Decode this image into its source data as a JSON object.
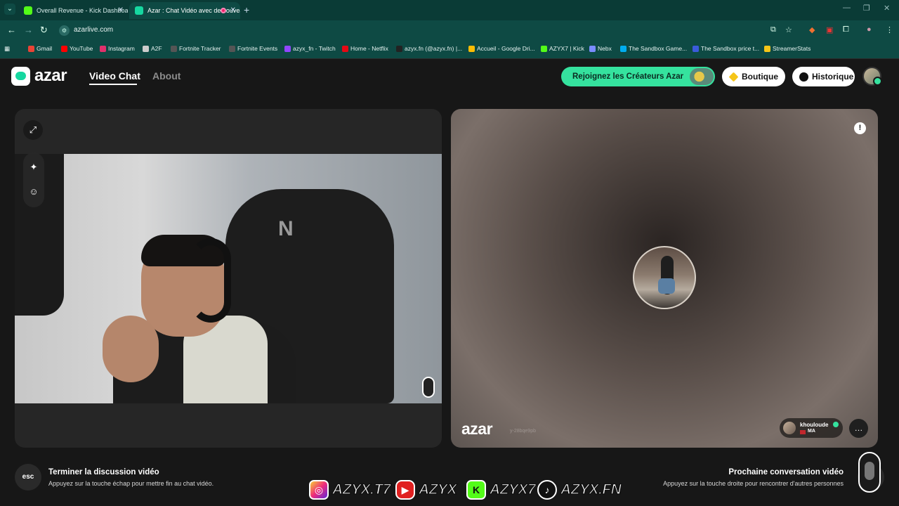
{
  "browser": {
    "tabs": [
      {
        "title": "Overall Revenue - Kick Dashboard",
        "active": false,
        "favicon_color": "#53fc18"
      },
      {
        "title": "Azar : Chat Vidéo avec de nouveaux",
        "active": true,
        "favicon_color": "#16d7a0"
      }
    ],
    "url": "azarlive.com",
    "bookmarks": [
      {
        "label": "Gmail",
        "icon_color": "#ea4335"
      },
      {
        "label": "YouTube",
        "icon_color": "#ff0000"
      },
      {
        "label": "Instagram",
        "icon_color": "#e1306c"
      },
      {
        "label": "A2F",
        "icon_color": "#cccccc"
      },
      {
        "label": "Fortnite Tracker",
        "icon_color": "#333333"
      },
      {
        "label": "Fortnite Events",
        "icon_color": "#333333"
      },
      {
        "label": "azyx_fn - Twitch",
        "icon_color": "#9146ff"
      },
      {
        "label": "Home - Netflix",
        "icon_color": "#e50914"
      },
      {
        "label": "azyx.fn (@azyx.fn) |...",
        "icon_color": "#111111"
      },
      {
        "label": "Accueil - Google Dri...",
        "icon_color": "#fbbc04"
      },
      {
        "label": "AZYX7 | Kick",
        "icon_color": "#53fc18"
      },
      {
        "label": "Nebx",
        "icon_color": "#7a8cff"
      },
      {
        "label": "The Sandbox Game...",
        "icon_color": "#00adef"
      },
      {
        "label": "The Sandbox price t...",
        "icon_color": "#3b5bdb"
      },
      {
        "label": "StreamerStats",
        "icon_color": "#f5c518"
      }
    ]
  },
  "header": {
    "logo_text": "azar",
    "nav": {
      "video_chat": "Video Chat",
      "about": "About"
    },
    "cta_label": "Rejoignez les Créateurs Azar",
    "shop_label": "Boutique",
    "history_label": "Historique"
  },
  "remote": {
    "watermark": "azar",
    "watermark_id": "y-28bqe9pb",
    "peer_name": "khouloude",
    "peer_country": "MA"
  },
  "footer": {
    "esc_key": "esc",
    "end_title": "Terminer la discussion vidéo",
    "end_sub": "Appuyez sur la touche échap pour mettre fin au chat vidéo.",
    "next_title": "Prochaine conversation vidéo",
    "next_sub": "Appuyez sur la touche droite pour rencontrer d'autres personnes"
  },
  "overlay": {
    "instagram": "AZYX.T7",
    "youtube": "AZYX",
    "kick": "AZYX7",
    "tiktok": "AZYX.FN"
  },
  "icons": {
    "expand": "expand-icon",
    "magic": "magic-wand-icon",
    "face": "face-filter-icon",
    "report": "report-icon",
    "chat": "chat-bubble-icon",
    "shop": "diamond-icon",
    "history": "clock-icon"
  }
}
